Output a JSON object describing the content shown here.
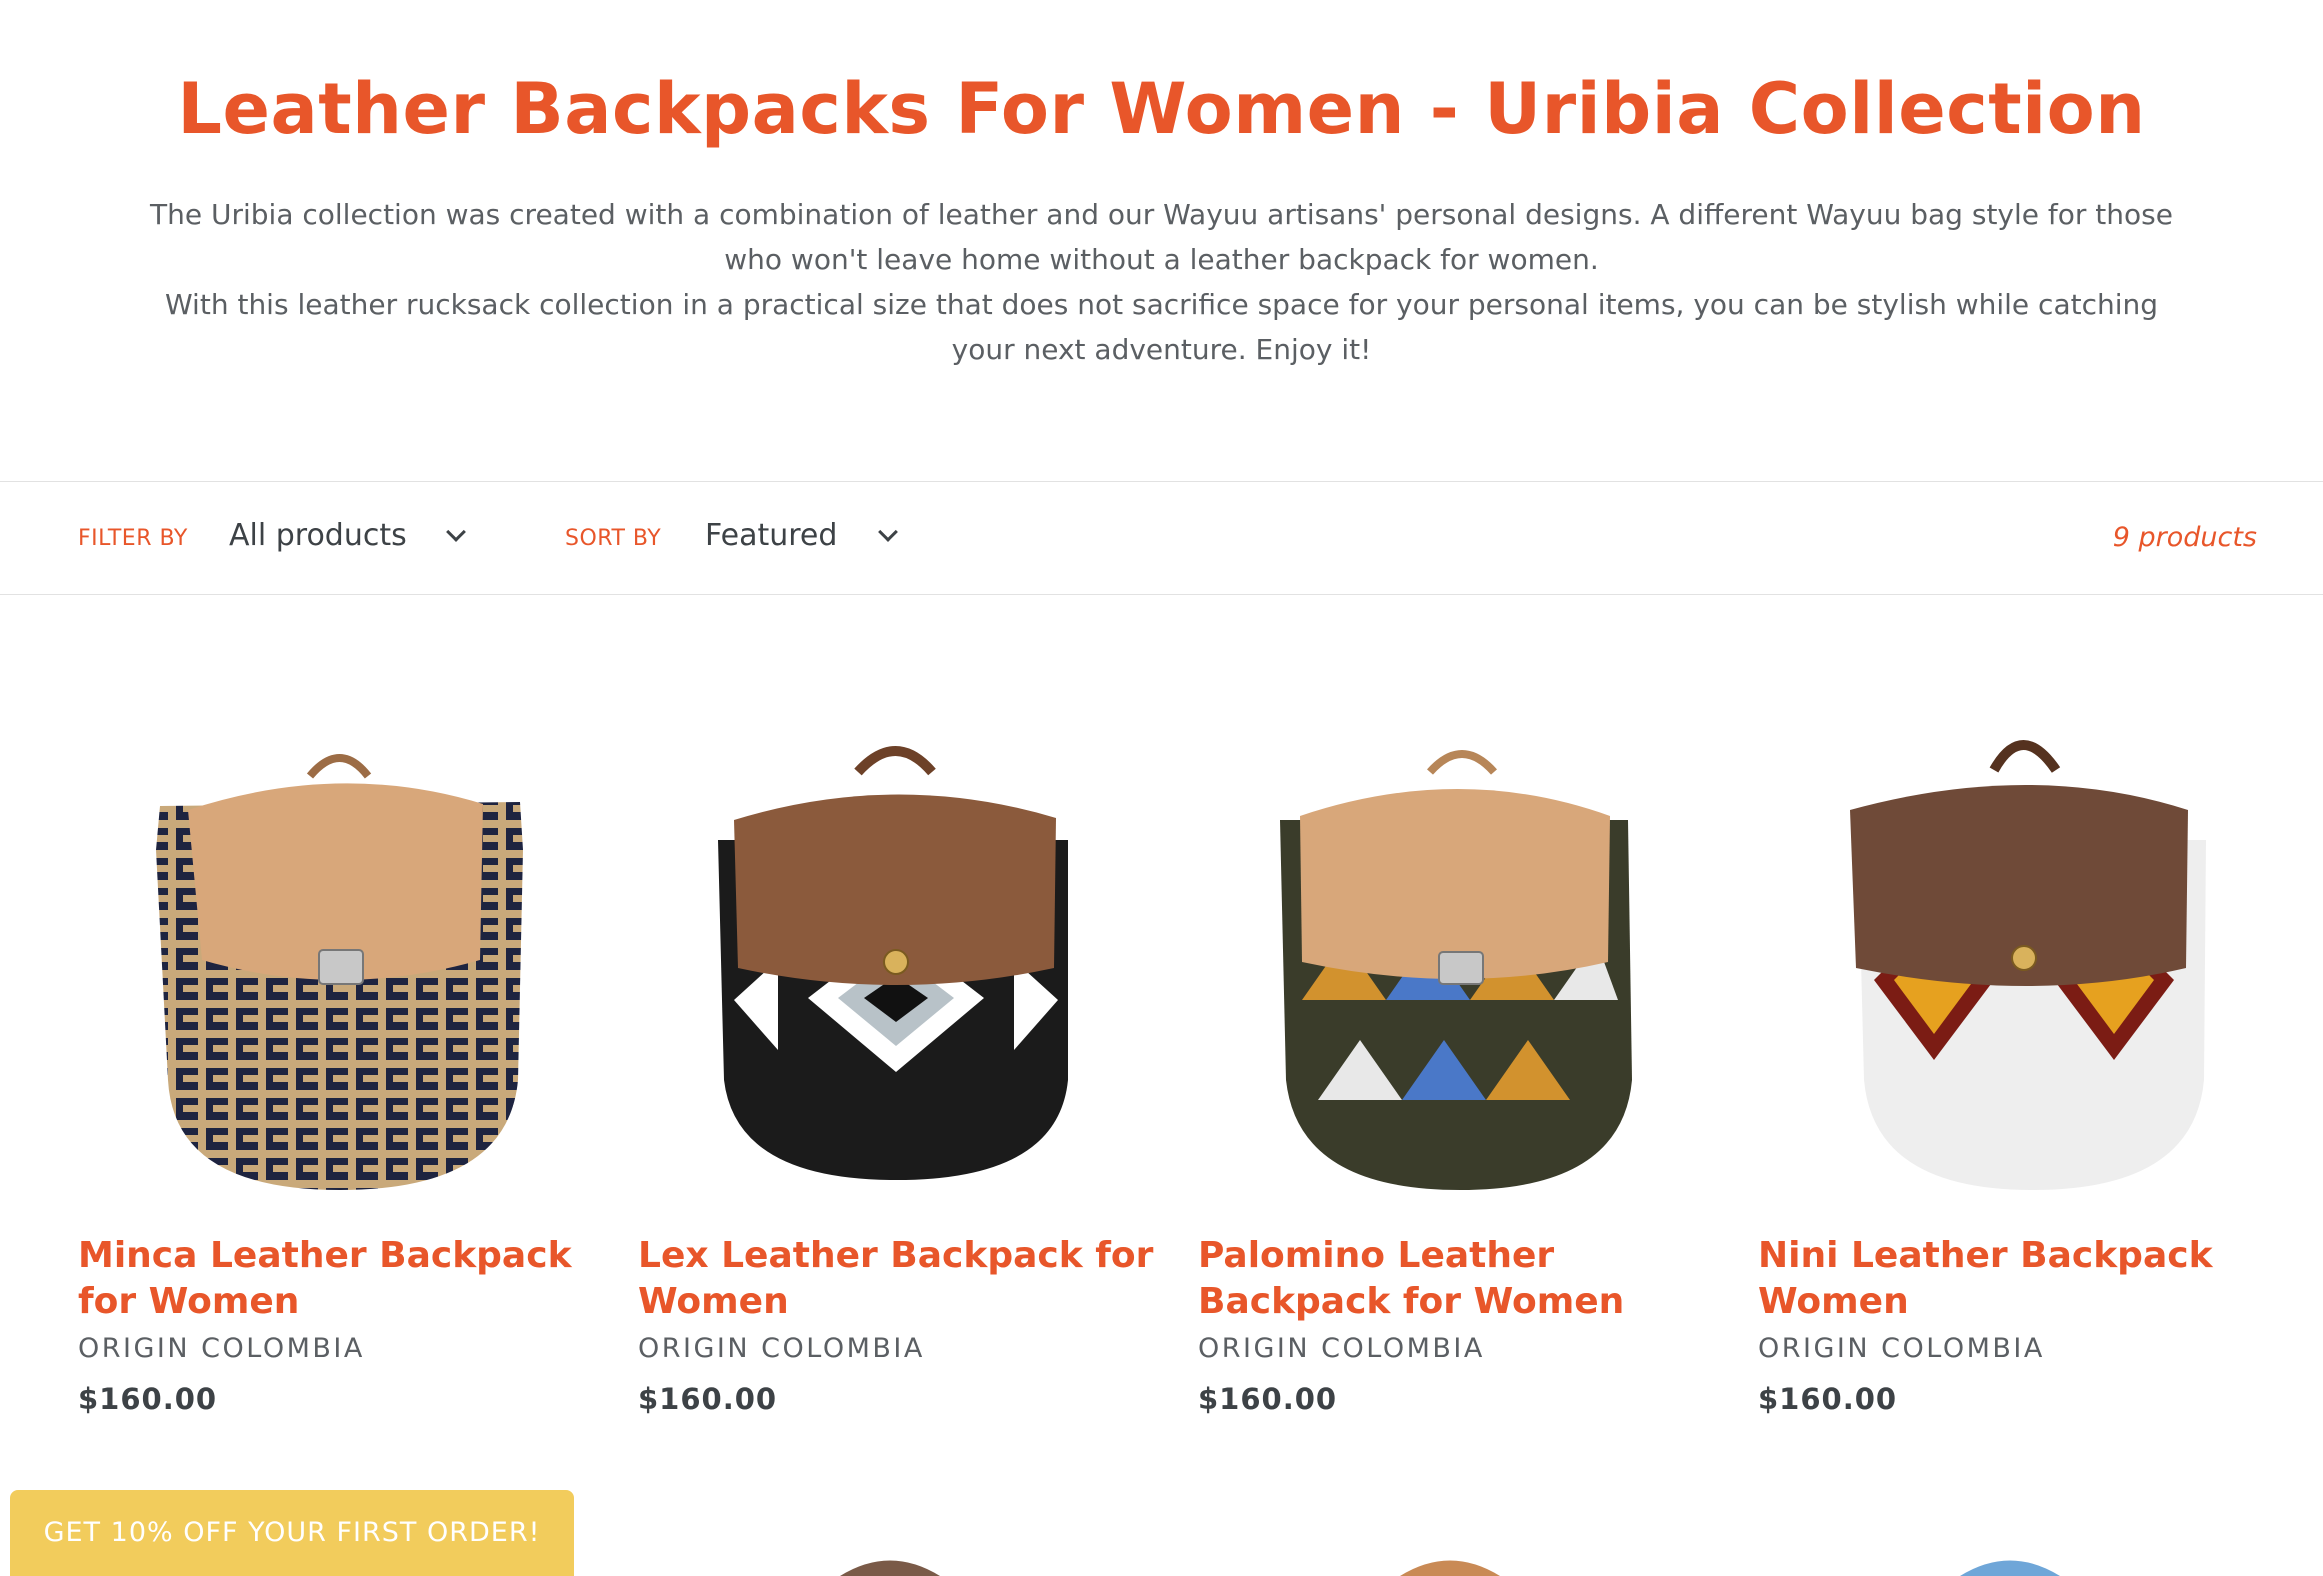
{
  "collection": {
    "title": "Leather Backpacks For Women - Uribia Collection",
    "description_1": "The Uribia collection was created with a combination of leather and our Wayuu artisans' personal designs. A different Wayuu bag style for those who won't leave home without a leather backpack for women.",
    "description_2": "With this leather rucksack collection in a practical size that does not sacrifice space for your personal items, you can be stylish while catching your next adventure. Enjoy it!"
  },
  "filters": {
    "filter_label": "Filter by",
    "filter_value": "All products",
    "sort_label": "Sort by",
    "sort_value": "Featured",
    "product_count": "9 products"
  },
  "products": [
    {
      "title": "Minca Leather Backpack for Women",
      "vendor": "Origin Colombia",
      "price": "$160.00",
      "image_icon": "backpack-image"
    },
    {
      "title": "Lex Leather Backpack for Women",
      "vendor": "Origin Colombia",
      "price": "$160.00",
      "image_icon": "backpack-image"
    },
    {
      "title": "Palomino Leather Backpack for Women",
      "vendor": "Origin Colombia",
      "price": "$160.00",
      "image_icon": "backpack-image"
    },
    {
      "title": "Nini Leather Backpack Women",
      "vendor": "Origin Colombia",
      "price": "$160.00",
      "image_icon": "backpack-image"
    }
  ],
  "promo": {
    "label": "Get 10% off your first order!"
  },
  "colors": {
    "accent": "#e8562a",
    "promo": "#f2cc5c",
    "text": "#3d4246"
  }
}
